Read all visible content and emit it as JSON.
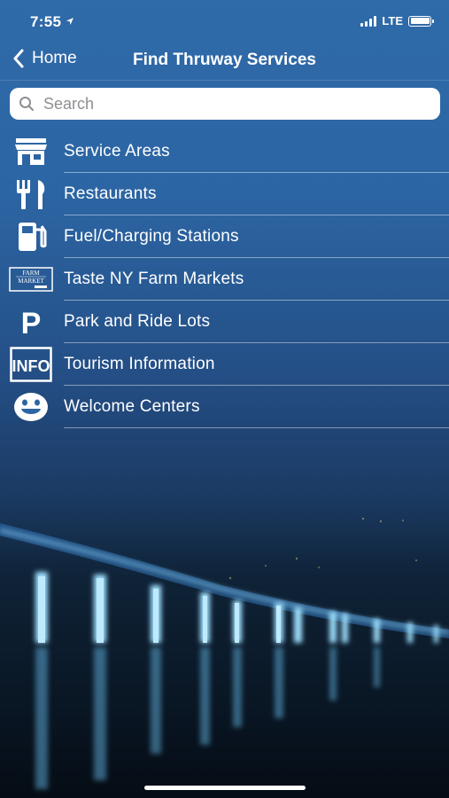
{
  "status": {
    "time": "7:55",
    "network": "LTE"
  },
  "nav": {
    "back_label": "Home",
    "title": "Find Thruway Services"
  },
  "search": {
    "placeholder": "Search"
  },
  "menu": {
    "items": [
      {
        "label": "Service Areas",
        "icon": "store-icon"
      },
      {
        "label": "Restaurants",
        "icon": "fork-knife-icon"
      },
      {
        "label": "Fuel/Charging Stations",
        "icon": "fuel-pump-icon"
      },
      {
        "label": "Taste NY Farm Markets",
        "icon": "farm-market-icon",
        "icon_text": [
          "FARM",
          "MARKET"
        ]
      },
      {
        "label": "Park and Ride Lots",
        "icon": "parking-icon",
        "icon_text": "P"
      },
      {
        "label": "Tourism Information",
        "icon": "info-icon",
        "icon_text": "INFO"
      },
      {
        "label": "Welcome Centers",
        "icon": "smiley-icon"
      }
    ]
  },
  "colors": {
    "background_top": "#2f6aa9",
    "background_bottom": "#07111c",
    "bridge_light": "#7fd0ff"
  }
}
